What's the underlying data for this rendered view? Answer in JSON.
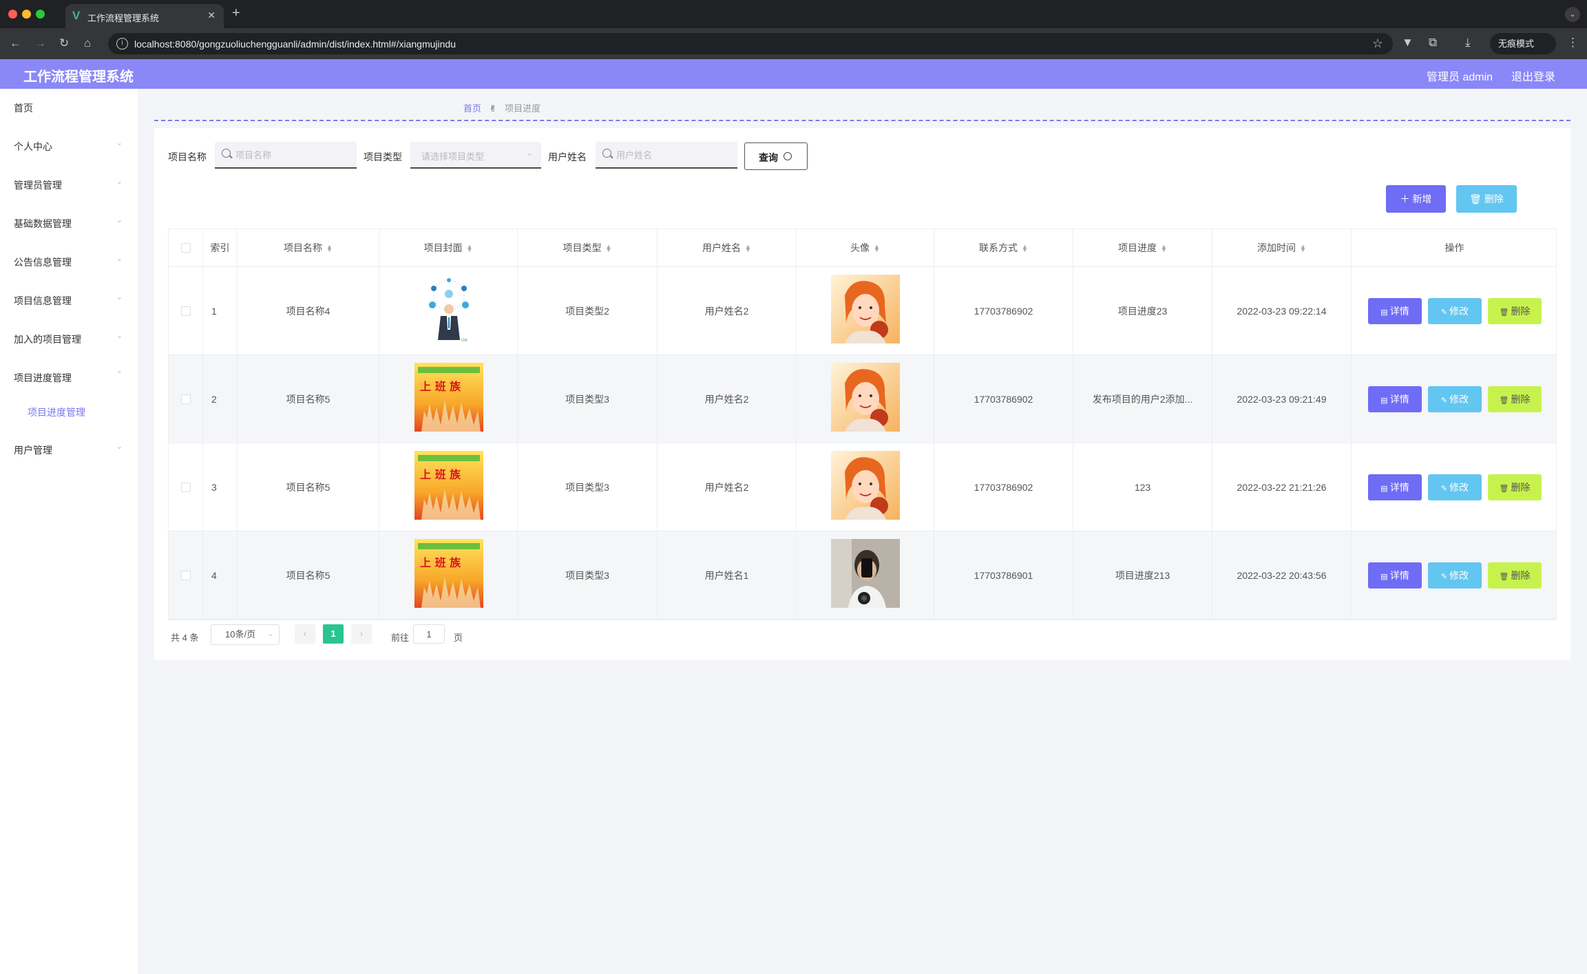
{
  "browser": {
    "tab_title": "工作流程管理系统",
    "url": "localhost:8080/gongzuoliuchengguanli/admin/dist/index.html#/xiangmujindu",
    "incognito_label": "无痕模式"
  },
  "header": {
    "app_title": "工作流程管理系统",
    "admin_label": "管理员 admin",
    "logout_label": "退出登录"
  },
  "sidebar": {
    "items": [
      {
        "label": "首页"
      },
      {
        "label": "个人中心"
      },
      {
        "label": "管理员管理"
      },
      {
        "label": "基础数据管理"
      },
      {
        "label": "公告信息管理"
      },
      {
        "label": "项目信息管理"
      },
      {
        "label": "加入的项目管理"
      },
      {
        "label": "项目进度管理"
      },
      {
        "label": "用户管理"
      }
    ],
    "active_sub": "项目进度管理"
  },
  "breadcrumb": {
    "home": "首页",
    "current": "项目进度"
  },
  "filters": {
    "name_label": "项目名称",
    "name_placeholder": "项目名称",
    "type_label": "项目类型",
    "type_placeholder": "请选择项目类型",
    "user_label": "用户姓名",
    "user_placeholder": "用户姓名",
    "query_label": "查询"
  },
  "actions": {
    "add_label": "新增",
    "delete_label": "删除"
  },
  "table": {
    "columns": [
      "索引",
      "项目名称",
      "项目封面",
      "项目类型",
      "用户姓名",
      "头像",
      "联系方式",
      "项目进度",
      "添加时间",
      "操作"
    ],
    "rows": [
      {
        "index": "1",
        "name": "项目名称4",
        "type": "项目类型2",
        "user": "用户姓名2",
        "phone": "17703786902",
        "progress": "项目进度23",
        "time": "2022-03-23 09:22:14",
        "cover": "business-man",
        "avatar": "girl"
      },
      {
        "index": "2",
        "name": "项目名称5",
        "type": "项目类型3",
        "user": "用户姓名2",
        "phone": "17703786902",
        "progress": "发布项目的用户2添加...",
        "time": "2022-03-23 09:21:49",
        "cover": "poster",
        "avatar": "girl"
      },
      {
        "index": "3",
        "name": "项目名称5",
        "type": "项目类型3",
        "user": "用户姓名2",
        "phone": "17703786902",
        "progress": "123",
        "time": "2022-03-22 21:21:26",
        "cover": "poster",
        "avatar": "girl"
      },
      {
        "index": "4",
        "name": "项目名称5",
        "type": "项目类型3",
        "user": "用户姓名1",
        "phone": "17703786901",
        "progress": "项目进度213",
        "time": "2022-03-22 20:43:56",
        "cover": "poster",
        "avatar": "boy"
      }
    ],
    "row_actions": {
      "detail": "详情",
      "edit": "修改",
      "delete": "删除"
    }
  },
  "pagination": {
    "total": "共 4 条",
    "page_size": "10条/页",
    "current_page": "1",
    "goto_label": "前往",
    "goto_value": "1",
    "page_suffix": "页"
  },
  "colors": {
    "accent": "#8a87f7",
    "primary_button": "#6f6cf5",
    "info_button": "#62c6f1",
    "lime_button": "#c7f24e",
    "pager_active": "#2ac48f"
  }
}
